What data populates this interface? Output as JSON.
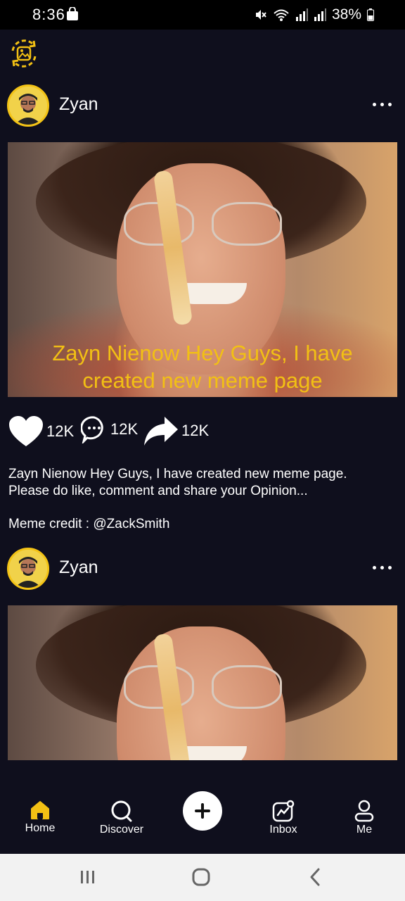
{
  "status_bar": {
    "time": "8:36",
    "battery": "38%"
  },
  "posts": [
    {
      "username": "Zyan",
      "image_overlay_text": "Zayn Nienow Hey Guys,  I have created new meme page",
      "likes": "12K",
      "comments": "12K",
      "shares": "12K",
      "caption": "Zayn Nienow Hey Guys, I have created new meme page. Please do like, comment and share your Opinion...",
      "credit": "Meme credit : @ZackSmith"
    },
    {
      "username": "Zyan"
    }
  ],
  "bottom_nav": {
    "items": [
      {
        "label": "Home",
        "icon": "home-icon",
        "active": true
      },
      {
        "label": "Discover",
        "icon": "search-icon",
        "active": false
      },
      {
        "label": "",
        "icon": "plus-icon",
        "active": false
      },
      {
        "label": "Inbox",
        "icon": "inbox-icon",
        "active": false
      },
      {
        "label": "Me",
        "icon": "profile-icon",
        "active": false
      }
    ]
  },
  "colors": {
    "accent": "#f2c014",
    "background": "#0f0f1d",
    "status_bar": "#000000",
    "system_nav": "#f2f2f2"
  }
}
